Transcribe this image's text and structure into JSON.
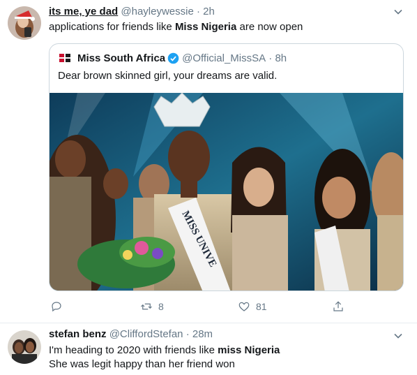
{
  "tweets": [
    {
      "name": "its me, ye dad",
      "handle": "@hayleywessie",
      "separator": "·",
      "time": "2h",
      "text_before": "applications for friends like ",
      "text_bold": "Miss Nigeria",
      "text_after": " are now open",
      "quote": {
        "name": "Miss South Africa",
        "handle": "@Official_MissSA",
        "separator": "·",
        "time": "8h",
        "text": "Dear brown skinned girl, your dreams are valid.",
        "sash_text": "MISS UNIVE"
      },
      "actions": {
        "reply_icon": "reply-icon",
        "retweet_icon": "retweet-icon",
        "retweet_count": "8",
        "like_icon": "heart-icon",
        "like_count": "81",
        "share_icon": "share-icon"
      }
    },
    {
      "name": "stefan benz",
      "handle": "@CliffordStefan",
      "separator": "·",
      "time": "28m",
      "line1_before": "I'm heading to 2020 with friends like ",
      "line1_bold": "miss Nigeria",
      "line2": "She was legit happy than her friend won"
    }
  ],
  "colors": {
    "verified": "#1da1f2",
    "secondary_text": "#657786",
    "border": "#e6ecf0"
  }
}
